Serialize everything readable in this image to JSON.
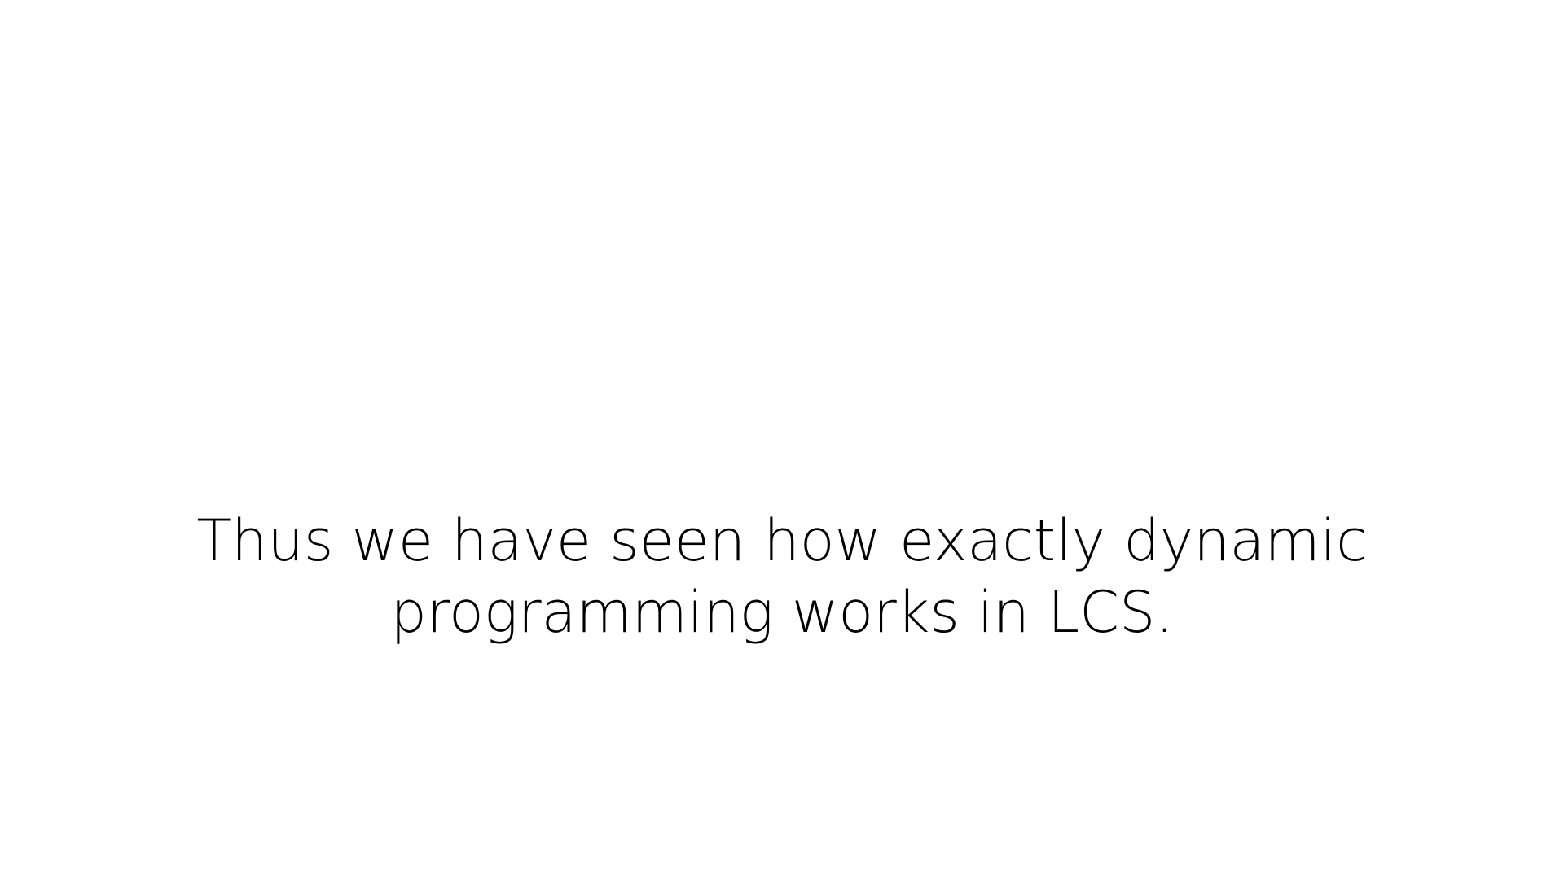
{
  "slide": {
    "body_lines": [
      "Thus we have seen how exactly dynamic",
      "programming works in LCS."
    ]
  }
}
